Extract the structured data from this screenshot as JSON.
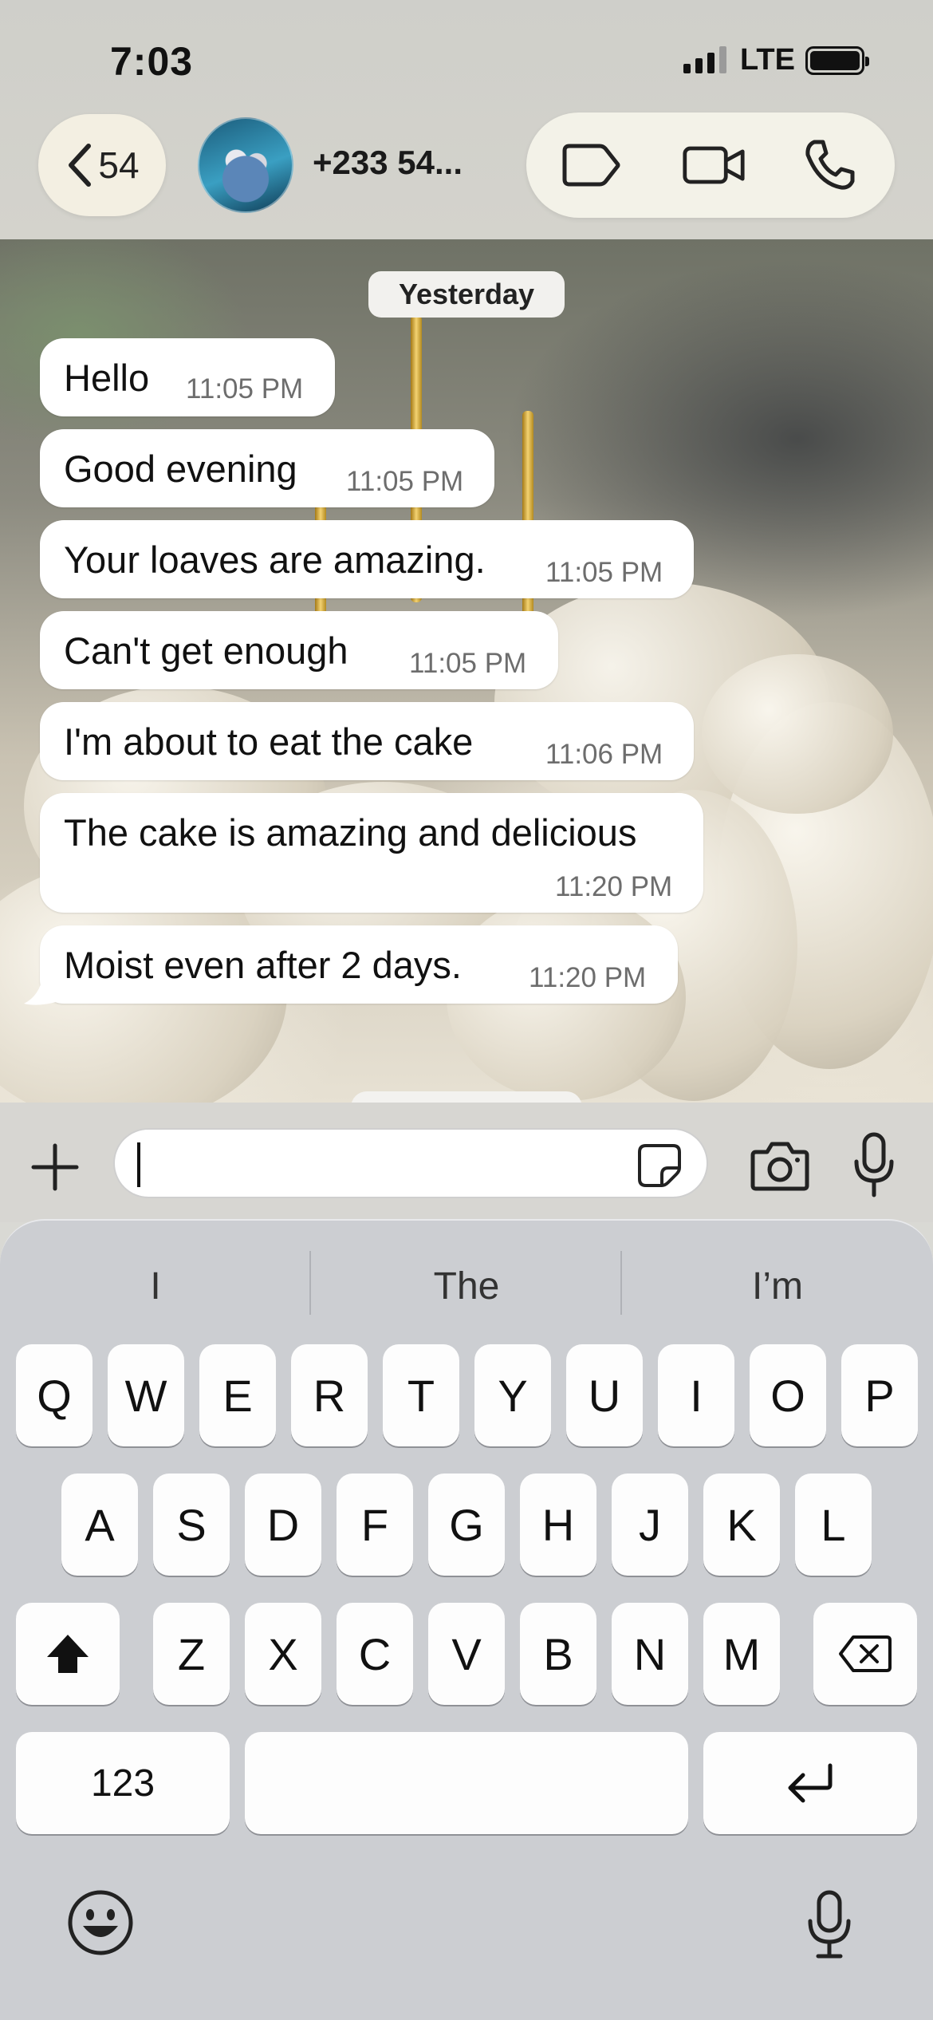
{
  "status_bar": {
    "time": "7:03",
    "network": "LTE"
  },
  "header": {
    "back_count": "54",
    "contact_name": "+233 54..."
  },
  "chat": {
    "date_label": "Yesterday",
    "messages": [
      {
        "text": "Hello",
        "time": "11:05 PM"
      },
      {
        "text": "Good evening",
        "time": "11:05 PM"
      },
      {
        "text": "Your loaves are amazing.",
        "time": "11:05 PM"
      },
      {
        "text": "Can't get enough",
        "time": "11:05 PM"
      },
      {
        "text": "I'm about to eat the cake",
        "time": "11:06 PM"
      },
      {
        "text": "The cake is amazing and delicious",
        "time": "11:20 PM"
      },
      {
        "text": "Moist even after 2 days.",
        "time": "11:20 PM"
      }
    ]
  },
  "composer": {
    "value": ""
  },
  "keyboard": {
    "suggestions": [
      "I",
      "The",
      "I’m"
    ],
    "row1": [
      "Q",
      "W",
      "E",
      "R",
      "T",
      "Y",
      "U",
      "I",
      "O",
      "P"
    ],
    "row2": [
      "A",
      "S",
      "D",
      "F",
      "G",
      "H",
      "J",
      "K",
      "L"
    ],
    "row3": [
      "Z",
      "X",
      "C",
      "V",
      "B",
      "N",
      "M"
    ],
    "numbers_label": "123"
  },
  "icons": {
    "back": "chevron-left-icon",
    "label": "tag-icon",
    "video": "video-call-icon",
    "call": "phone-icon",
    "attach": "plus-icon",
    "sticker": "sticker-icon",
    "camera": "camera-icon",
    "mic": "microphone-icon",
    "shift": "shift-icon",
    "delete": "backspace-icon",
    "return": "return-icon",
    "emoji": "emoji-icon",
    "dictation": "dictation-mic-icon"
  }
}
